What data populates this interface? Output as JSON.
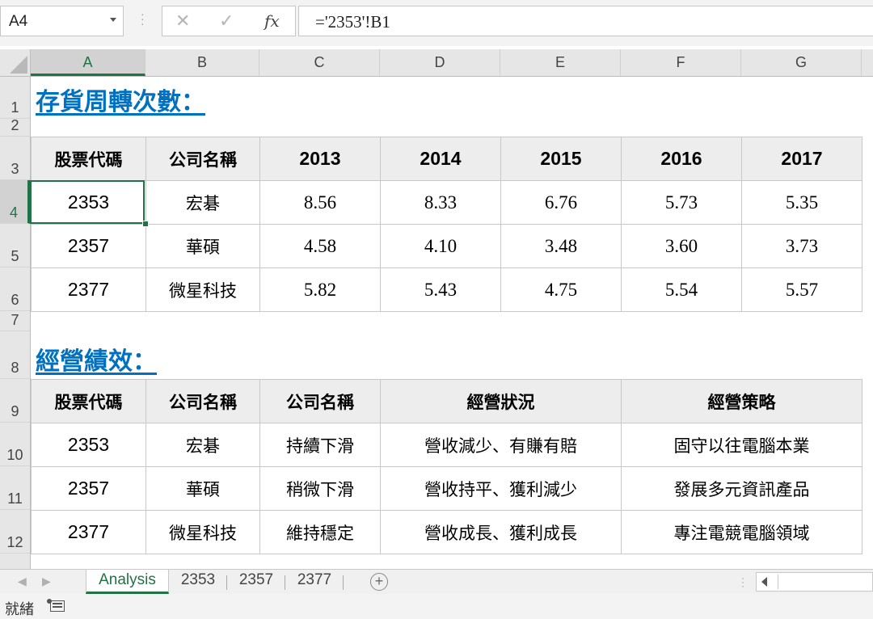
{
  "formula_bar": {
    "name_box": "A4",
    "fx_label": "fx",
    "cancel_glyph": "✕",
    "enter_glyph": "✓",
    "formula": "='2353'!B1"
  },
  "columns": [
    "A",
    "B",
    "C",
    "D",
    "E",
    "F",
    "G"
  ],
  "rows": [
    "1",
    "2",
    "3",
    "4",
    "5",
    "6",
    "7",
    "8",
    "9",
    "10",
    "11",
    "12"
  ],
  "selected_cell": {
    "column": "A",
    "row": "4"
  },
  "section1": {
    "title": "存貨周轉次數：",
    "headers": [
      "股票代碼",
      "公司名稱",
      "2013",
      "2014",
      "2015",
      "2016",
      "2017"
    ],
    "rows": [
      [
        "2353",
        "宏碁",
        "8.56",
        "8.33",
        "6.76",
        "5.73",
        "5.35"
      ],
      [
        "2357",
        "華碩",
        "4.58",
        "4.10",
        "3.48",
        "3.60",
        "3.73"
      ],
      [
        "2377",
        "微星科技",
        "5.82",
        "5.43",
        "4.75",
        "5.54",
        "5.57"
      ]
    ]
  },
  "section2": {
    "title": "經營績效：",
    "headers": [
      "股票代碼",
      "公司名稱",
      "公司名稱",
      "經營狀況",
      "經營策略"
    ],
    "rows": [
      [
        "2353",
        "宏碁",
        "持續下滑",
        "營收減少、有賺有賠",
        "固守以往電腦本業"
      ],
      [
        "2357",
        "華碩",
        "稍微下滑",
        "營收持平、獲利減少",
        "發展多元資訊產品"
      ],
      [
        "2377",
        "微星科技",
        "維持穩定",
        "營收成長、獲利成長",
        "專注電競電腦領域"
      ]
    ]
  },
  "sheet_tabs": [
    "Analysis",
    "2353",
    "2357",
    "2377"
  ],
  "active_sheet": "Analysis",
  "add_sheet_glyph": "+",
  "status": "就緒",
  "colors": {
    "accent": "#217346",
    "title": "#0070c0",
    "header_fill": "#ededed"
  }
}
